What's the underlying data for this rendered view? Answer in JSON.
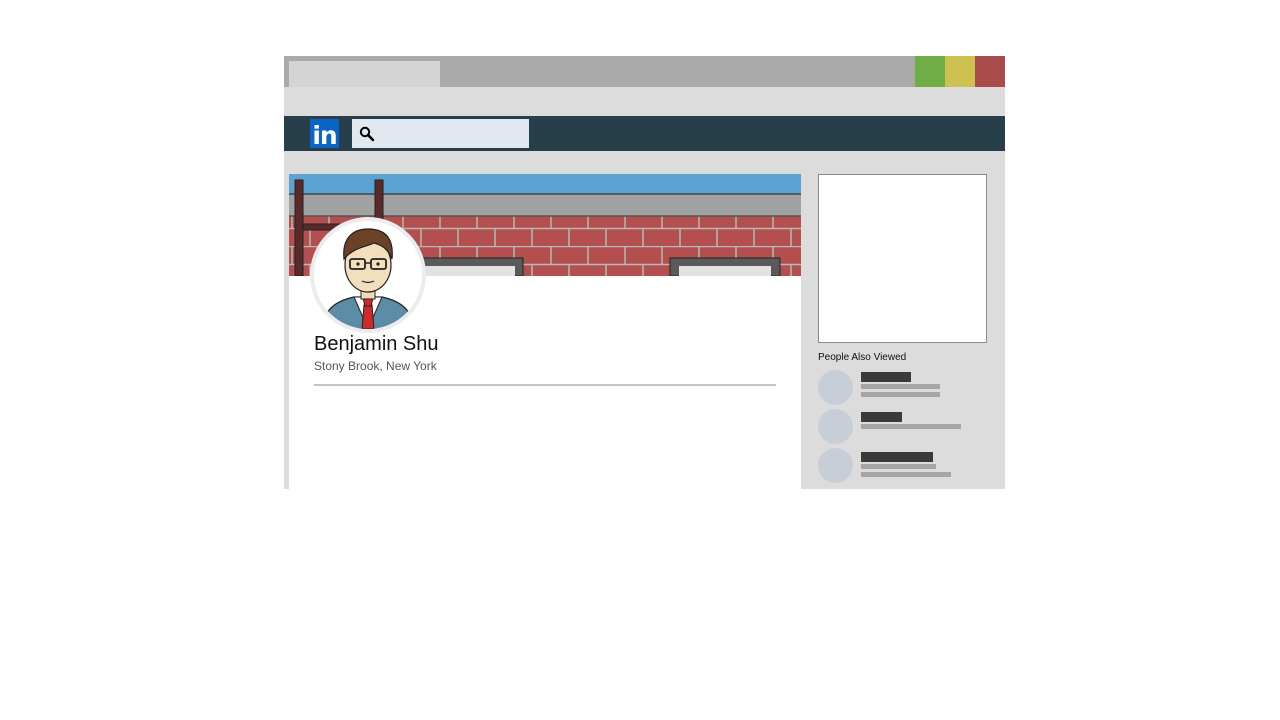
{
  "browser": {
    "tab_title": "",
    "address": "",
    "colors": {
      "minimize": "#70ad47",
      "maximize": "#cdc251",
      "close": "#a84b4b"
    }
  },
  "navbar": {
    "logo_text": "in",
    "search_icon": "search-icon",
    "search_value": "",
    "colors": {
      "background": "#263f4a",
      "logo": "#0a66c2",
      "search": "#e1e8f0"
    }
  },
  "profile": {
    "name": "Benjamin Shu",
    "location": "Stony Brook, New York",
    "cover": "brick-wall-illustration",
    "avatar": "man-with-glasses-and-tie-avatar"
  },
  "sidebar": {
    "people_also_viewed_title": "People Also Viewed",
    "people": [
      {
        "avatar": "placeholder-avatar"
      },
      {
        "avatar": "placeholder-avatar"
      },
      {
        "avatar": "placeholder-avatar"
      }
    ]
  }
}
